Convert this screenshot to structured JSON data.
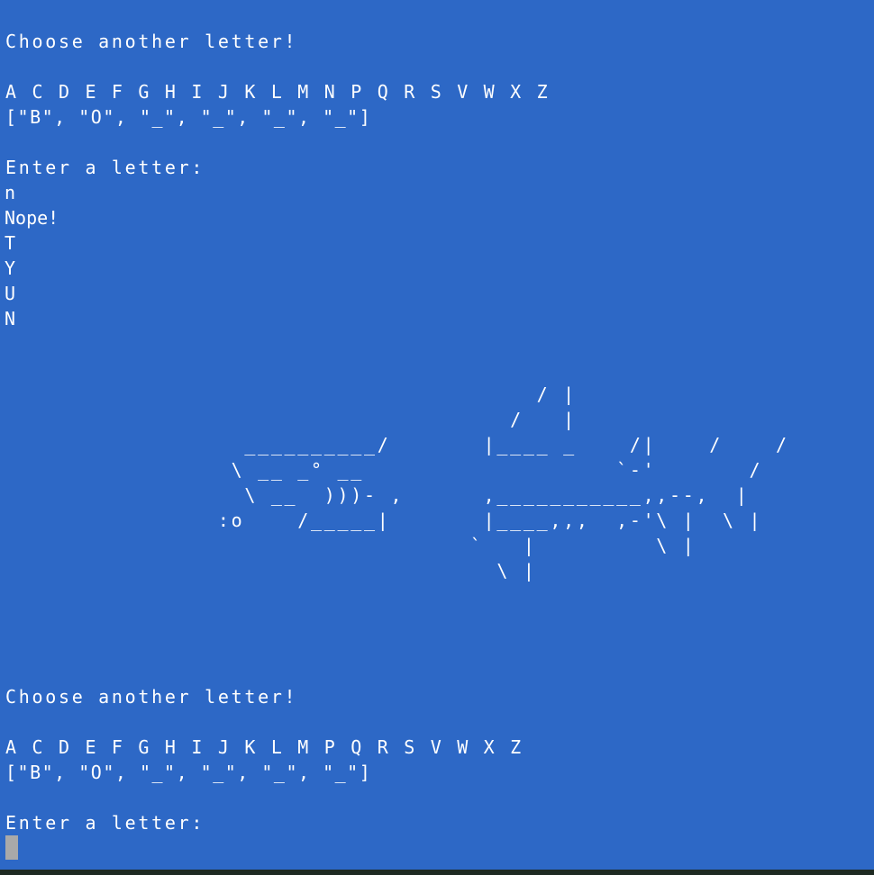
{
  "first_block": {
    "prompt": "Choose another letter!",
    "letters": "A C D E F G H I J K L M N P Q R S V W X Z",
    "word_state": "[\"B\", \"O\", \"_\", \"_\", \"_\", \"_\"]",
    "enter_prompt": "Enter a letter:",
    "input_1": "n",
    "result": "Nope!",
    "output_1": "T",
    "output_2": "Y",
    "output_3": "U",
    "output_4": "N"
  },
  "shark_art": "                                        / |                            _,-,\n                                      /   |                          /   /\n                  __________/       |____ _    /|    /    /\n                 \\ __ _° __                   `-'       /\n                  \\ __  )))- ,      ,___________,,--,  |\n                :o    /_____|       |____,,,  ,-'\\ |  \\ |\n                                   `   |         \\ |\n                                     \\ |",
  "second_block": {
    "prompt": "Choose another letter!",
    "letters": "A C D E F G H I J K L M P Q R S V W X Z",
    "word_state": "[\"B\", \"O\", \"_\", \"_\", \"_\", \"_\"]",
    "enter_prompt": "Enter a letter:"
  }
}
